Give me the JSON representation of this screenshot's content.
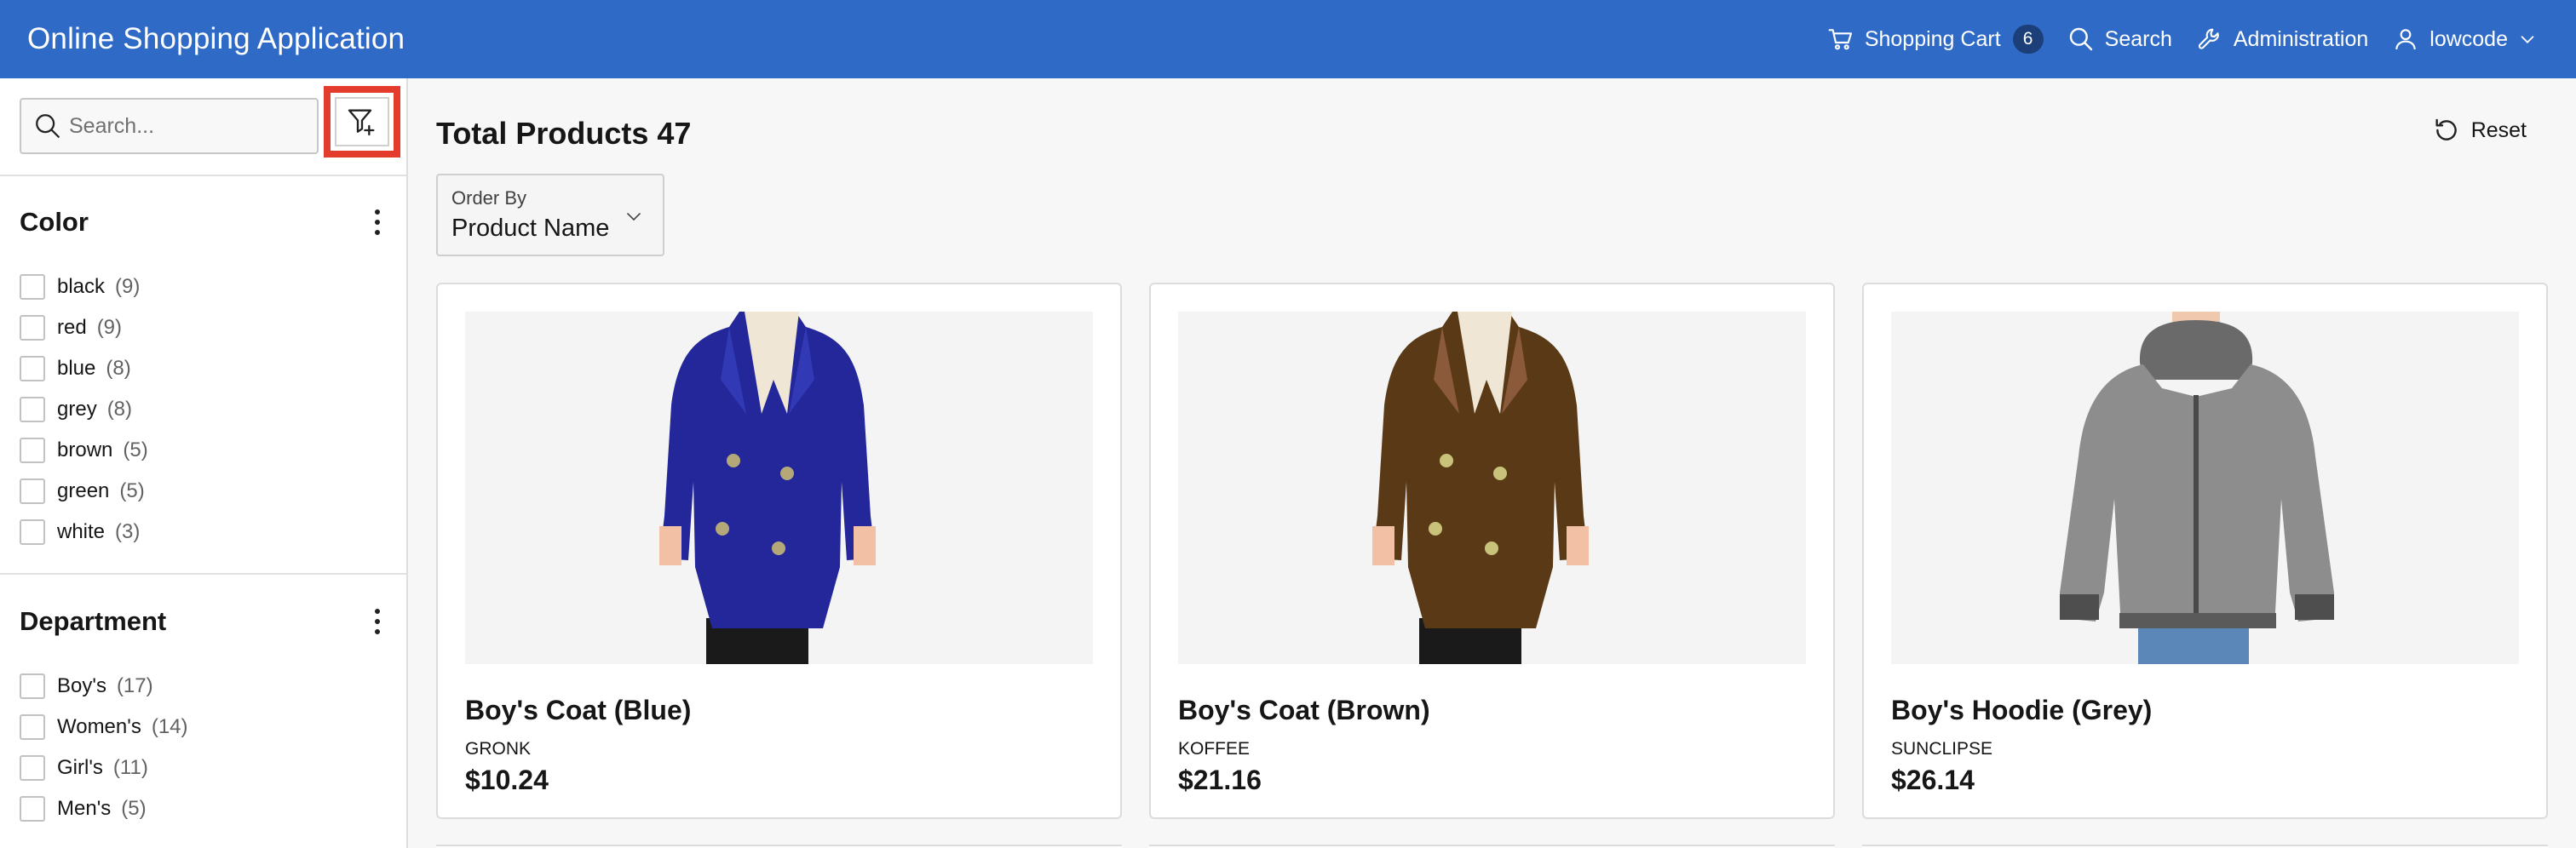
{
  "header": {
    "title": "Online Shopping Application",
    "cart_label": "Shopping Cart",
    "cart_count": "6",
    "search_label": "Search",
    "admin_label": "Administration",
    "user_label": "lowcode"
  },
  "sidebar": {
    "search_placeholder": "Search...",
    "facets": [
      {
        "title": "Color",
        "items": [
          {
            "label": "black",
            "count": "(9)"
          },
          {
            "label": "red",
            "count": "(9)"
          },
          {
            "label": "blue",
            "count": "(8)"
          },
          {
            "label": "grey",
            "count": "(8)"
          },
          {
            "label": "brown",
            "count": "(5)"
          },
          {
            "label": "green",
            "count": "(5)"
          },
          {
            "label": "white",
            "count": "(3)"
          }
        ]
      },
      {
        "title": "Department",
        "items": [
          {
            "label": "Boy's",
            "count": "(17)"
          },
          {
            "label": "Women's",
            "count": "(14)"
          },
          {
            "label": "Girl's",
            "count": "(11)"
          },
          {
            "label": "Men's",
            "count": "(5)"
          }
        ]
      }
    ]
  },
  "main": {
    "total_label": "Total Products",
    "total_count": "47",
    "reset_label": "Reset",
    "order_by_label": "Order By",
    "order_by_value": "Product Name",
    "products": [
      {
        "name": "Boy's Coat (Blue)",
        "brand": "GRONK",
        "price": "$10.24",
        "image": "blue-coat"
      },
      {
        "name": "Boy's Coat (Brown)",
        "brand": "KOFFEE",
        "price": "$21.16",
        "image": "brown-coat"
      },
      {
        "name": "Boy's Hoodie (Grey)",
        "brand": "SUNCLIPSE",
        "price": "$26.14",
        "image": "grey-hoodie"
      }
    ]
  },
  "colors": {
    "header_bg": "#2f6bc6",
    "highlight": "#e33b2c"
  }
}
